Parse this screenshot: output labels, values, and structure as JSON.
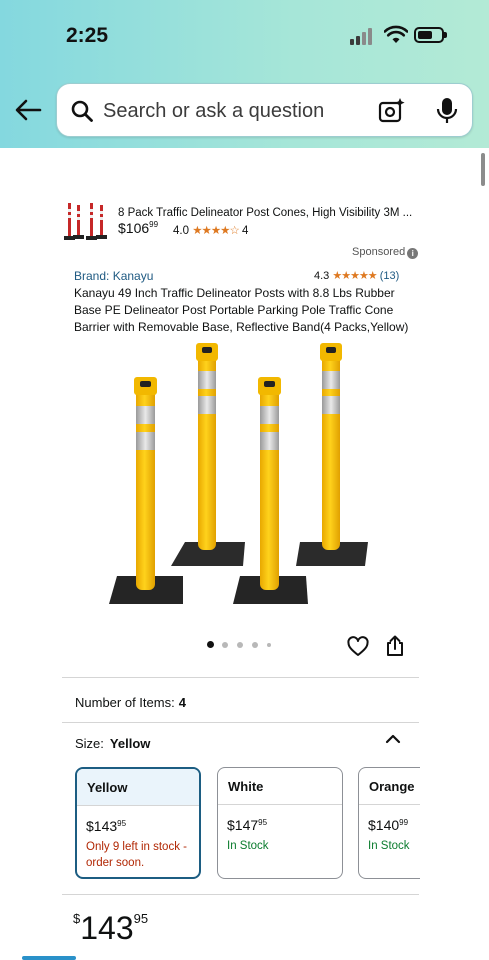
{
  "status_bar": {
    "time": "2:25",
    "signal_icon": "cellular-signal-icon",
    "wifi_icon": "wifi-icon",
    "battery_icon": "battery-icon"
  },
  "search": {
    "back_icon": "back-arrow-icon",
    "placeholder": "Search or ask a question",
    "camera_icon": "camera-icon",
    "mic_icon": "microphone-icon"
  },
  "sponsored_ad": {
    "title": "8 Pack Traffic Delineator Post Cones, High Visibility 3M ...",
    "price_whole": "$106",
    "price_fraction": "99",
    "rating": "4.0",
    "stars": "★★★★☆",
    "review_count": "4"
  },
  "sponsored_label": "Sponsored",
  "product": {
    "brand": "Brand: Kanayu",
    "rating": "4.3",
    "stars": "★★★★★",
    "review_count": "(13)",
    "title": "Kanayu 49 Inch Traffic Delineator Posts with 8.8 Lbs Rubber Base PE Delineator Post Portable Parking Pole Traffic Cone Barrier with Removable Base, Reflective Band(4 Packs,Yellow)",
    "image_count": 5,
    "image_index": 1,
    "heart_icon": "heart-icon",
    "share_icon": "share-icon"
  },
  "number_of_items": {
    "label": "Number of Items:",
    "value": "4"
  },
  "size": {
    "label": "Size:",
    "value": "Yellow",
    "collapse_icon": "chevron-up-icon"
  },
  "size_options": [
    {
      "name": "Yellow",
      "price_whole": "$143",
      "price_fraction": "95",
      "stock": "Only 9 left in stock - order soon.",
      "selected": true
    },
    {
      "name": "White",
      "price_whole": "$147",
      "price_fraction": "95",
      "stock": "In Stock",
      "selected": false
    },
    {
      "name": "Orange",
      "price_whole": "$140",
      "price_fraction": "99",
      "stock": "In Stock",
      "selected": false
    }
  ],
  "price": {
    "symbol": "$",
    "whole": "143",
    "fraction": "95"
  },
  "colors": {
    "header_gradient_start": "#84d8df",
    "header_gradient_end": "#b3ead6",
    "link_blue": "#1f5a82",
    "star_orange": "#de7921",
    "in_stock_green": "#0b7c2e",
    "low_stock_red": "#b12704",
    "selected_border": "#1c5d82"
  }
}
